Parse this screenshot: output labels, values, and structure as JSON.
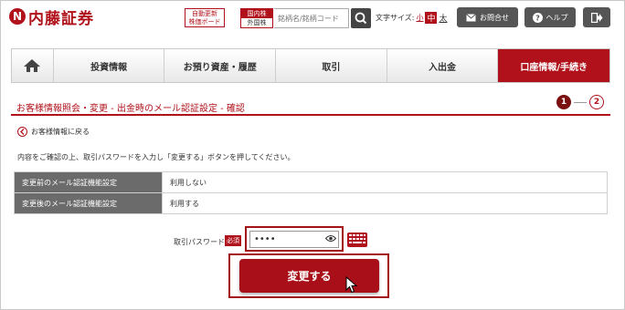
{
  "header": {
    "logo_text": "内藤証券",
    "logo_mark": "N",
    "auto_board_line1": "自動更新",
    "auto_board_line2": "株価ボード",
    "market_domestic": "国内株",
    "market_foreign": "外国株",
    "search_placeholder": "銘柄名/銘柄コード",
    "font_size_label": "文字サイズ:",
    "font_small": "小",
    "font_mid": "中",
    "font_large": "太",
    "contact_label": "お問合せ",
    "help_label": "ヘルプ",
    "brand_color": "#b0111a"
  },
  "nav": {
    "items": [
      {
        "label": "投資情報"
      },
      {
        "label": "お預り資産・履歴"
      },
      {
        "label": "取引"
      },
      {
        "label": "入出金"
      },
      {
        "label": "口座情報/手続き"
      }
    ]
  },
  "page": {
    "title": "お客様情報照会・変更 - 出金時のメール認証設定 - 確認",
    "step1": "1",
    "step2": "2",
    "back_link": "お客様情報に戻る",
    "instruction": "内容をご確認の上、取引パスワードを入力し「変更する」ボタンを押してください。"
  },
  "table": {
    "rows": [
      {
        "label": "変更前のメール認証機能設定",
        "value": "利用しない"
      },
      {
        "label": "変更後のメール認証機能設定",
        "value": "利用する"
      }
    ]
  },
  "form": {
    "password_label": "取引パスワード",
    "required_badge": "必須",
    "password_value": "••••",
    "submit_label": "変更する"
  }
}
